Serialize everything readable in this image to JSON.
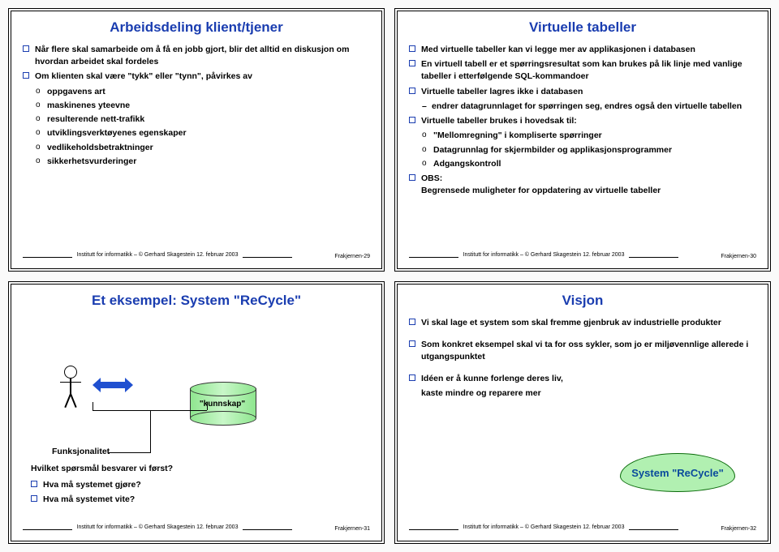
{
  "footer": {
    "credit": "Institutt for informatikk – © Gerhard Skagestein 12. februar 2003",
    "page_prefix": "Frakjernen-"
  },
  "slides": {
    "s29": {
      "title": "Arbeidsdeling klient/tjener",
      "b1": "Når flere skal samarbeide om å få en jobb gjort, blir det alltid en diskusjon om hvordan arbeidet skal fordeles",
      "b2": "Om klienten skal være \"tykk\" eller \"tynn\", påvirkes av",
      "o1": "oppgavens art",
      "o2": "maskinenes yteevne",
      "o3": "resulterende nett-trafikk",
      "o4": "utviklingsverktøyenes egenskaper",
      "o5": "vedlikeholdsbetraktninger",
      "o6": "sikkerhetsvurderinger",
      "page": "29"
    },
    "s30": {
      "title": "Virtuelle tabeller",
      "b1": "Med virtuelle tabeller kan vi legge mer av applikasjonen i databasen",
      "b2": "En virtuell tabell er et spørringsresultat som kan brukes på lik linje med vanlige tabeller i etterfølgende SQL-kommandoer",
      "b3": "Virtuelle tabeller lagres ikke i databasen",
      "d1": "endrer datagrunnlaget for spørringen seg, endres også den virtuelle tabellen",
      "b4": "Virtuelle tabeller brukes i hovedsak til:",
      "o1": "\"Mellomregning\" i kompliserte spørringer",
      "o2": "Datagrunnlag for skjermbilder og applikasjonsprogrammer",
      "o3": "Adgangskontroll",
      "b5": "OBS:",
      "b5_2": "Begrensede muligheter for oppdatering av virtuelle tabeller",
      "page": "30"
    },
    "s31": {
      "title": "Et eksempel: System \"ReCycle\"",
      "db_label": "\"kunnskap\"",
      "funk": "Funksjonalitet",
      "q_heading": "Hvilket spørsmål besvarer vi først?",
      "q1": "Hva må systemet gjøre?",
      "q2": "Hva må systemet vite?",
      "page": "31"
    },
    "s32": {
      "title": "Visjon",
      "b1": "Vi skal lage et system som skal fremme gjenbruk av industrielle produkter",
      "b2": "Som konkret eksempel skal vi ta for oss sykler, som jo er miljøvennlige allerede i utgangspunktet",
      "b3": "Idéen er å kunne forlenge deres liv,",
      "b3_2": "kaste mindre og reparere mer",
      "cloud": "System \"ReCycle\"",
      "page": "32"
    }
  }
}
